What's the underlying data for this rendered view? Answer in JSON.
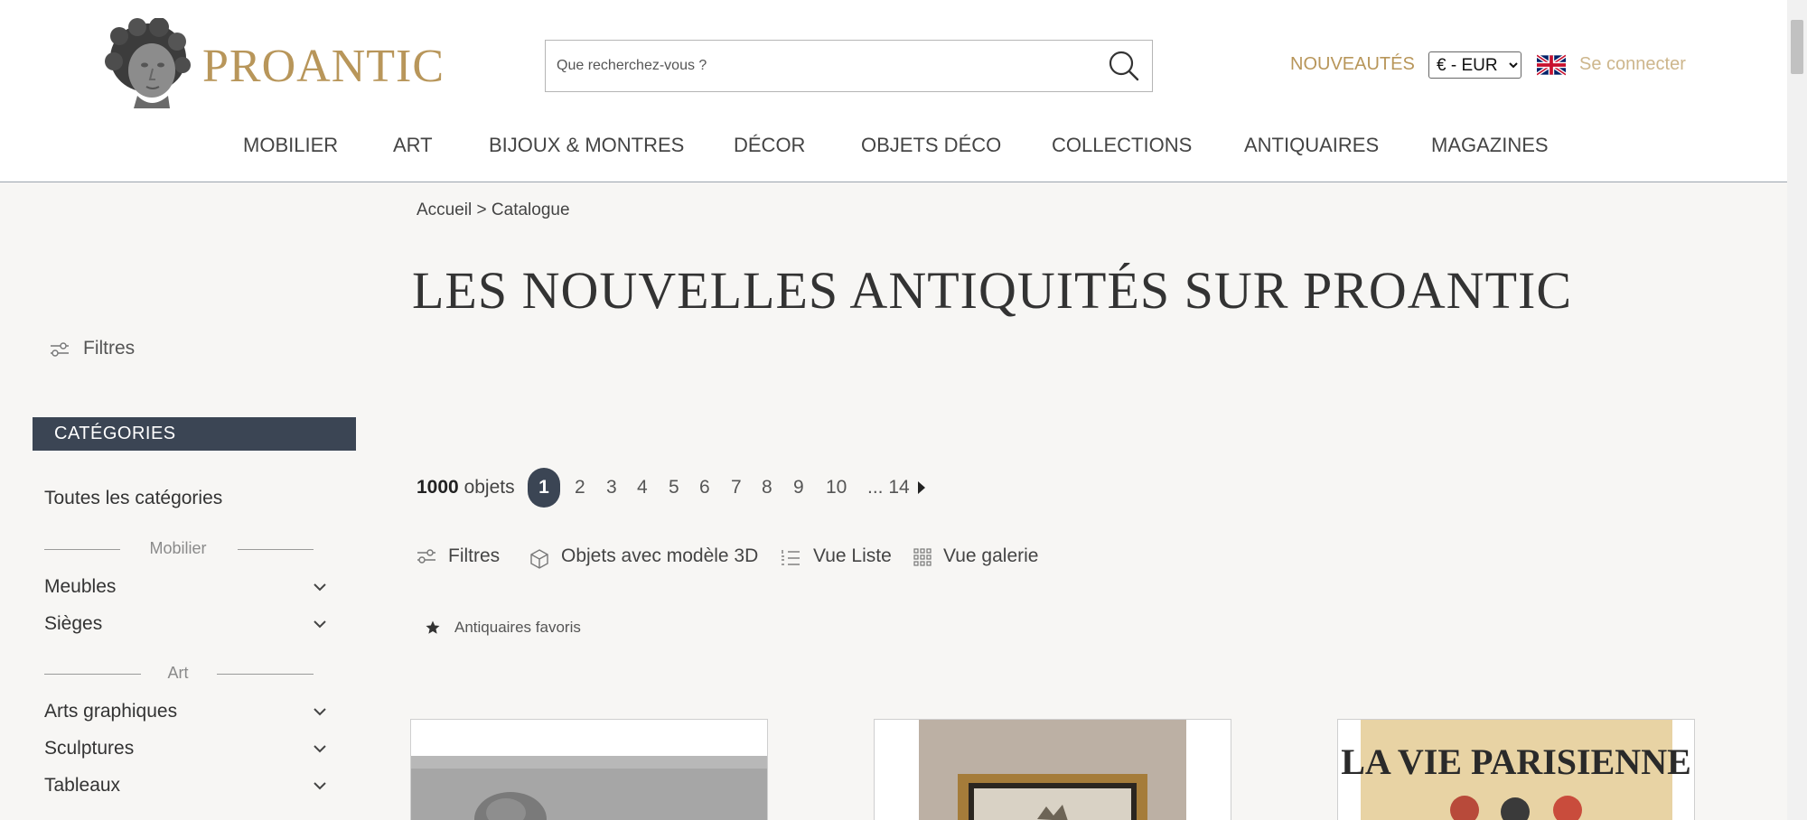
{
  "header": {
    "logo_text": "PROANTIC",
    "search_placeholder": "Que recherchez-vous ?",
    "new_items_label": "NOUVEAUTÉS",
    "currency_selected": "€ - EUR",
    "login_label": "Se connecter",
    "accent_color": "#b8965a"
  },
  "nav": [
    "MOBILIER",
    "ART",
    "BIJOUX & MONTRES",
    "DÉCOR",
    "OBJETS DÉCO",
    "COLLECTIONS",
    "ANTIQUAIRES",
    "MAGAZINES"
  ],
  "sidebar": {
    "filters_label": "Filtres",
    "categories_header": "CATÉGORIES",
    "all_categories": "Toutes les catégories",
    "groups": [
      {
        "label": "Mobilier",
        "items": [
          "Meubles",
          "Sièges"
        ]
      },
      {
        "label": "Art",
        "items": [
          "Arts graphiques",
          "Sculptures",
          "Tableaux"
        ]
      }
    ]
  },
  "main": {
    "breadcrumb": "Accueil > Catalogue",
    "title": "LES NOUVELLES ANTIQUITÉS SUR PROANTIC",
    "results_count": "1000",
    "results_unit": "objets",
    "pages": [
      "1",
      "2",
      "3",
      "4",
      "5",
      "6",
      "7",
      "8",
      "9",
      "10",
      "... 14"
    ],
    "current_page": "1",
    "tools": {
      "filters": "Filtres",
      "models_3d": "Objets avec modèle 3D",
      "list_view": "Vue Liste",
      "gallery_view": "Vue galerie"
    },
    "favorites_label": "Antiquaires favoris",
    "card3_poster_text": "LA VIE PARISIENNE"
  }
}
